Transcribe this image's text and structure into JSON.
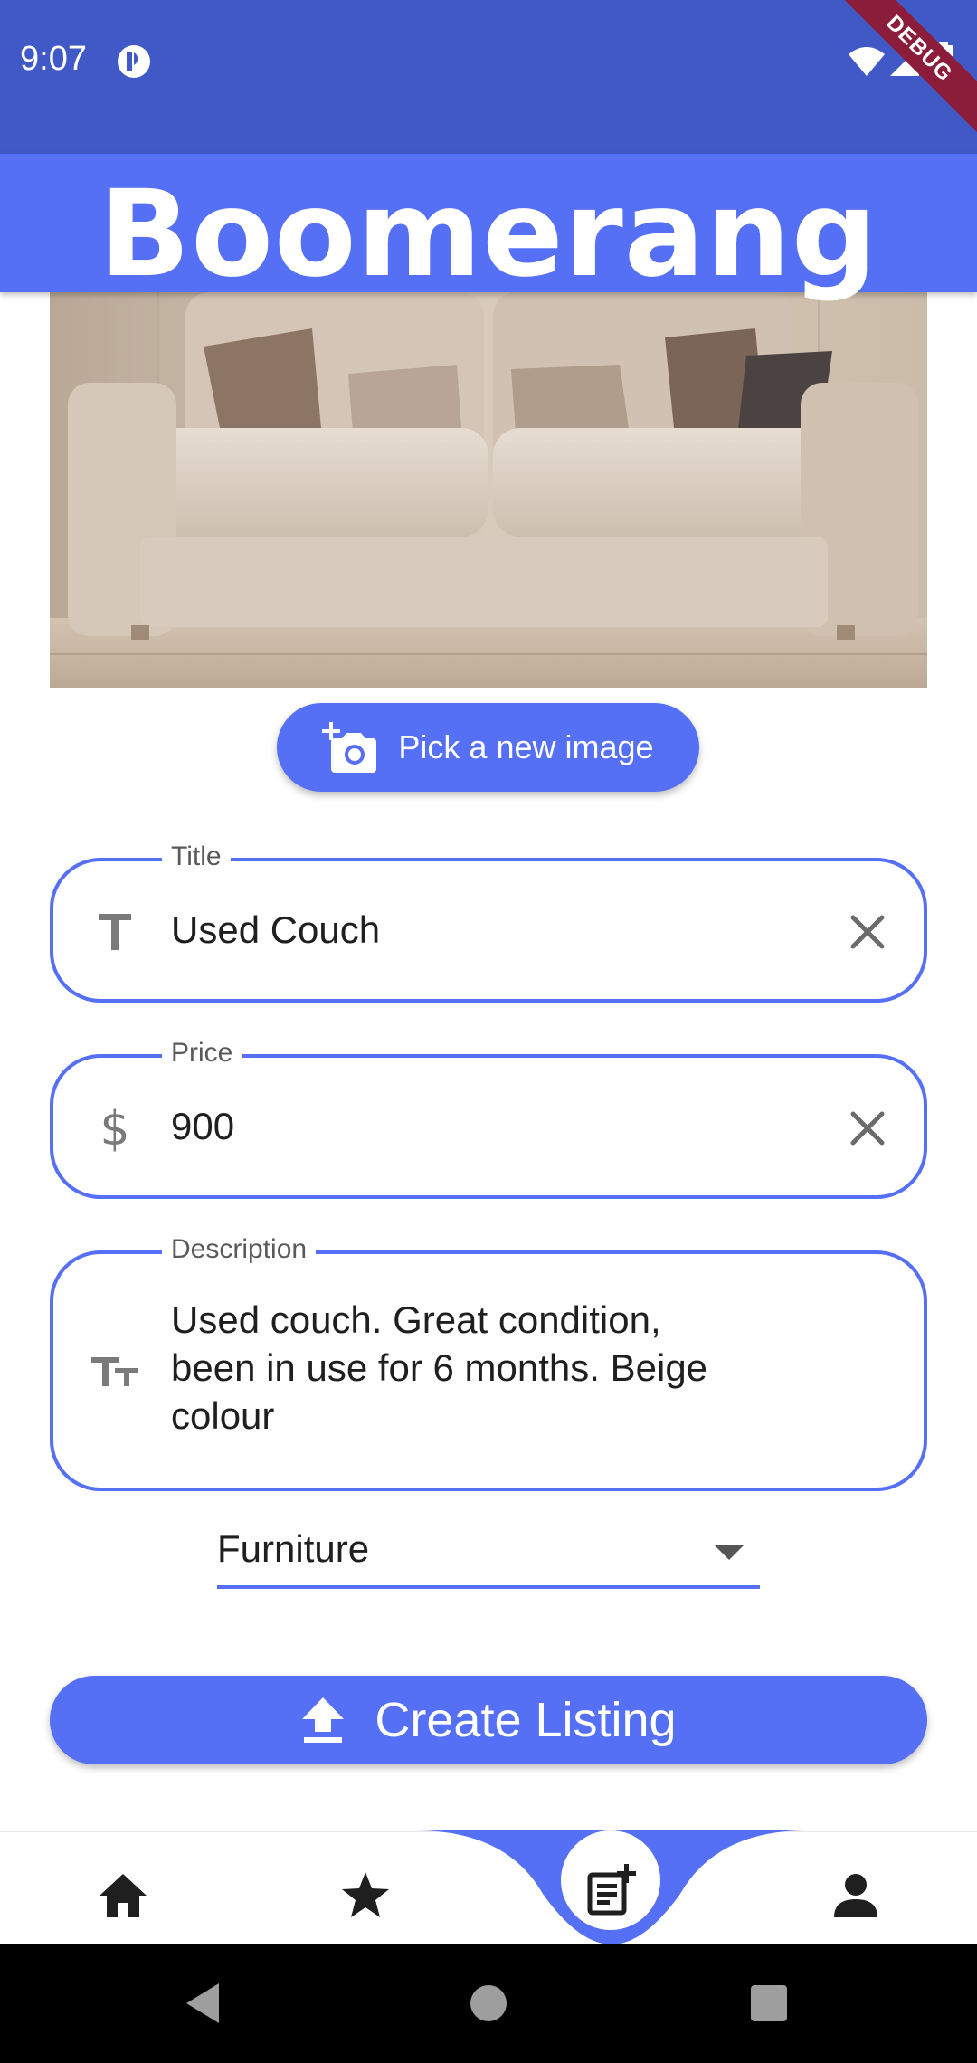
{
  "status_bar": {
    "time": "9:07",
    "debug_label": "DEBUG",
    "colors": {
      "background": "#4159c6"
    }
  },
  "app_bar": {
    "title": "Boomerang",
    "colors": {
      "background": "#5670f5"
    }
  },
  "image": {
    "alt": "Beige couch photo"
  },
  "pick_image_button": {
    "label": "Pick a new image",
    "icon": "add-a-photo-icon"
  },
  "form": {
    "title": {
      "label": "Title",
      "value": "Used Couch",
      "icon": "title-text-icon"
    },
    "price": {
      "label": "Price",
      "value": "900",
      "icon": "dollar-icon"
    },
    "description": {
      "label": "Description",
      "lines": [
        "Used couch. Great condition,",
        "been in use for 6 months. Beige",
        "colour"
      ],
      "icon": "text-fields-icon"
    },
    "category": {
      "selected": "Furniture"
    }
  },
  "create_button": {
    "label": "Create Listing",
    "icon": "upload-icon"
  },
  "bottom_nav": {
    "items": [
      "home-icon",
      "star-icon",
      "post-add-icon",
      "person-icon"
    ],
    "active_index": 2
  },
  "accent": "#5670f5"
}
